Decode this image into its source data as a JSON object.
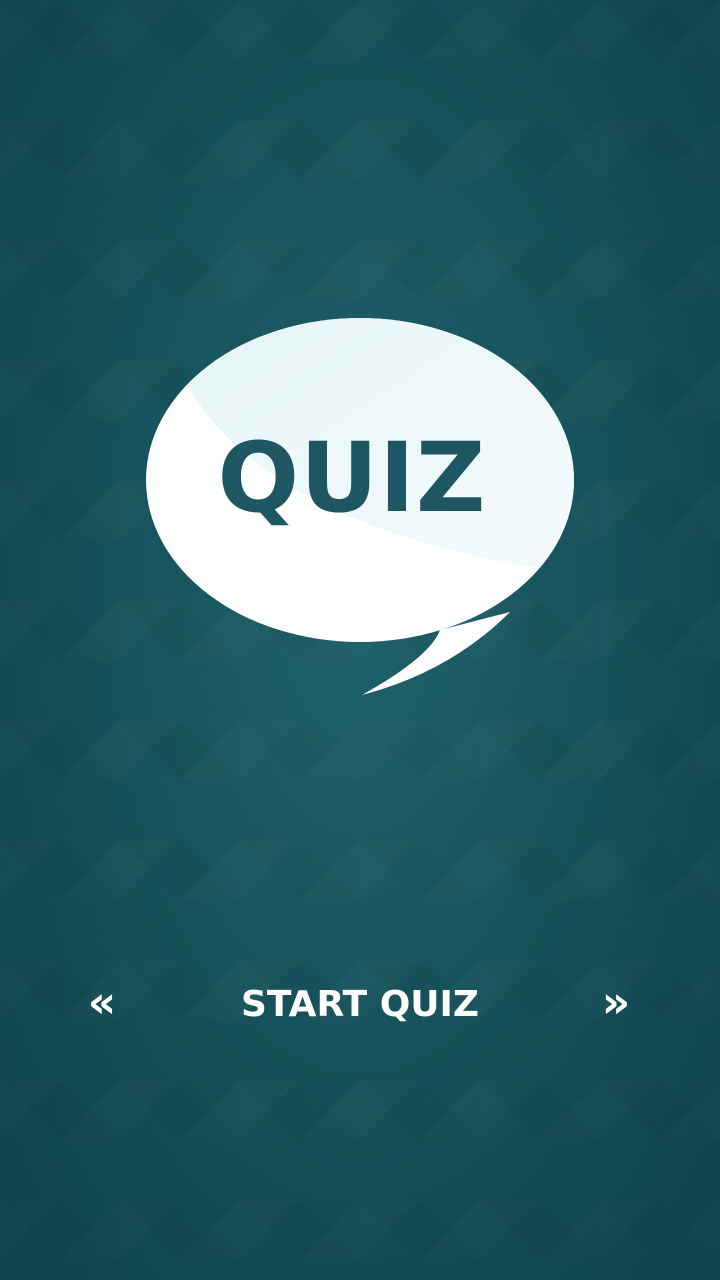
{
  "logo": {
    "text": "QUIZ"
  },
  "navigation": {
    "prev_symbol": "«",
    "next_symbol": "»",
    "start_label": "START QUIZ"
  },
  "colors": {
    "background": "#17545d",
    "bubble": "#ffffff",
    "logo_text": "#1e5662",
    "nav_text": "#ffffff"
  }
}
